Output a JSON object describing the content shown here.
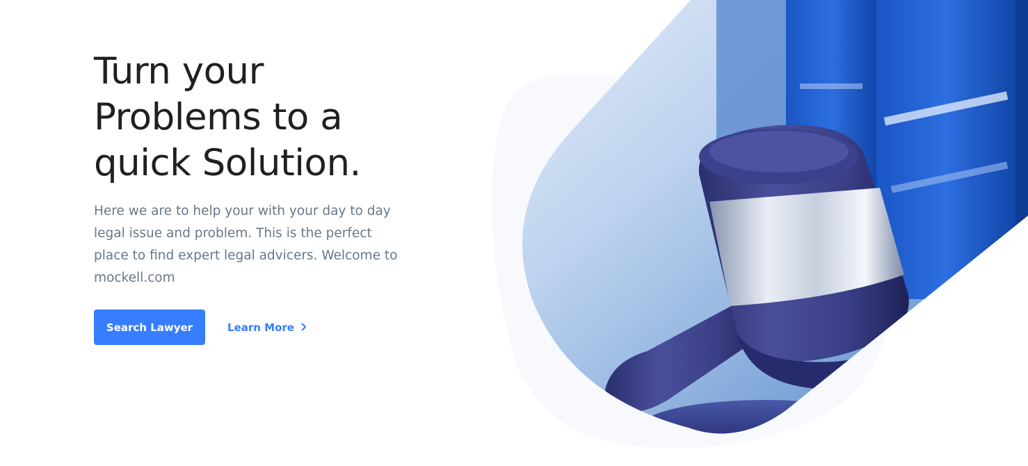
{
  "hero": {
    "title_lines": [
      "Turn your",
      "Problems to a",
      "quick Solution."
    ],
    "description_lines": [
      "Here we are to help your with your day to day",
      "legal issue and problem. This is the perfect",
      "place to find expert legal advicers. Welcome to",
      "mockell.com"
    ],
    "primary_button": "Search Lawyer",
    "secondary_link": "Learn More"
  },
  "colors": {
    "accent": "#377dff",
    "heading": "#1e2022",
    "body_text": "#677788",
    "blob_background": "#f7f9fd"
  },
  "image": {
    "subject": "judge-gavel-and-law-books",
    "icon": "chevron-right-icon"
  }
}
